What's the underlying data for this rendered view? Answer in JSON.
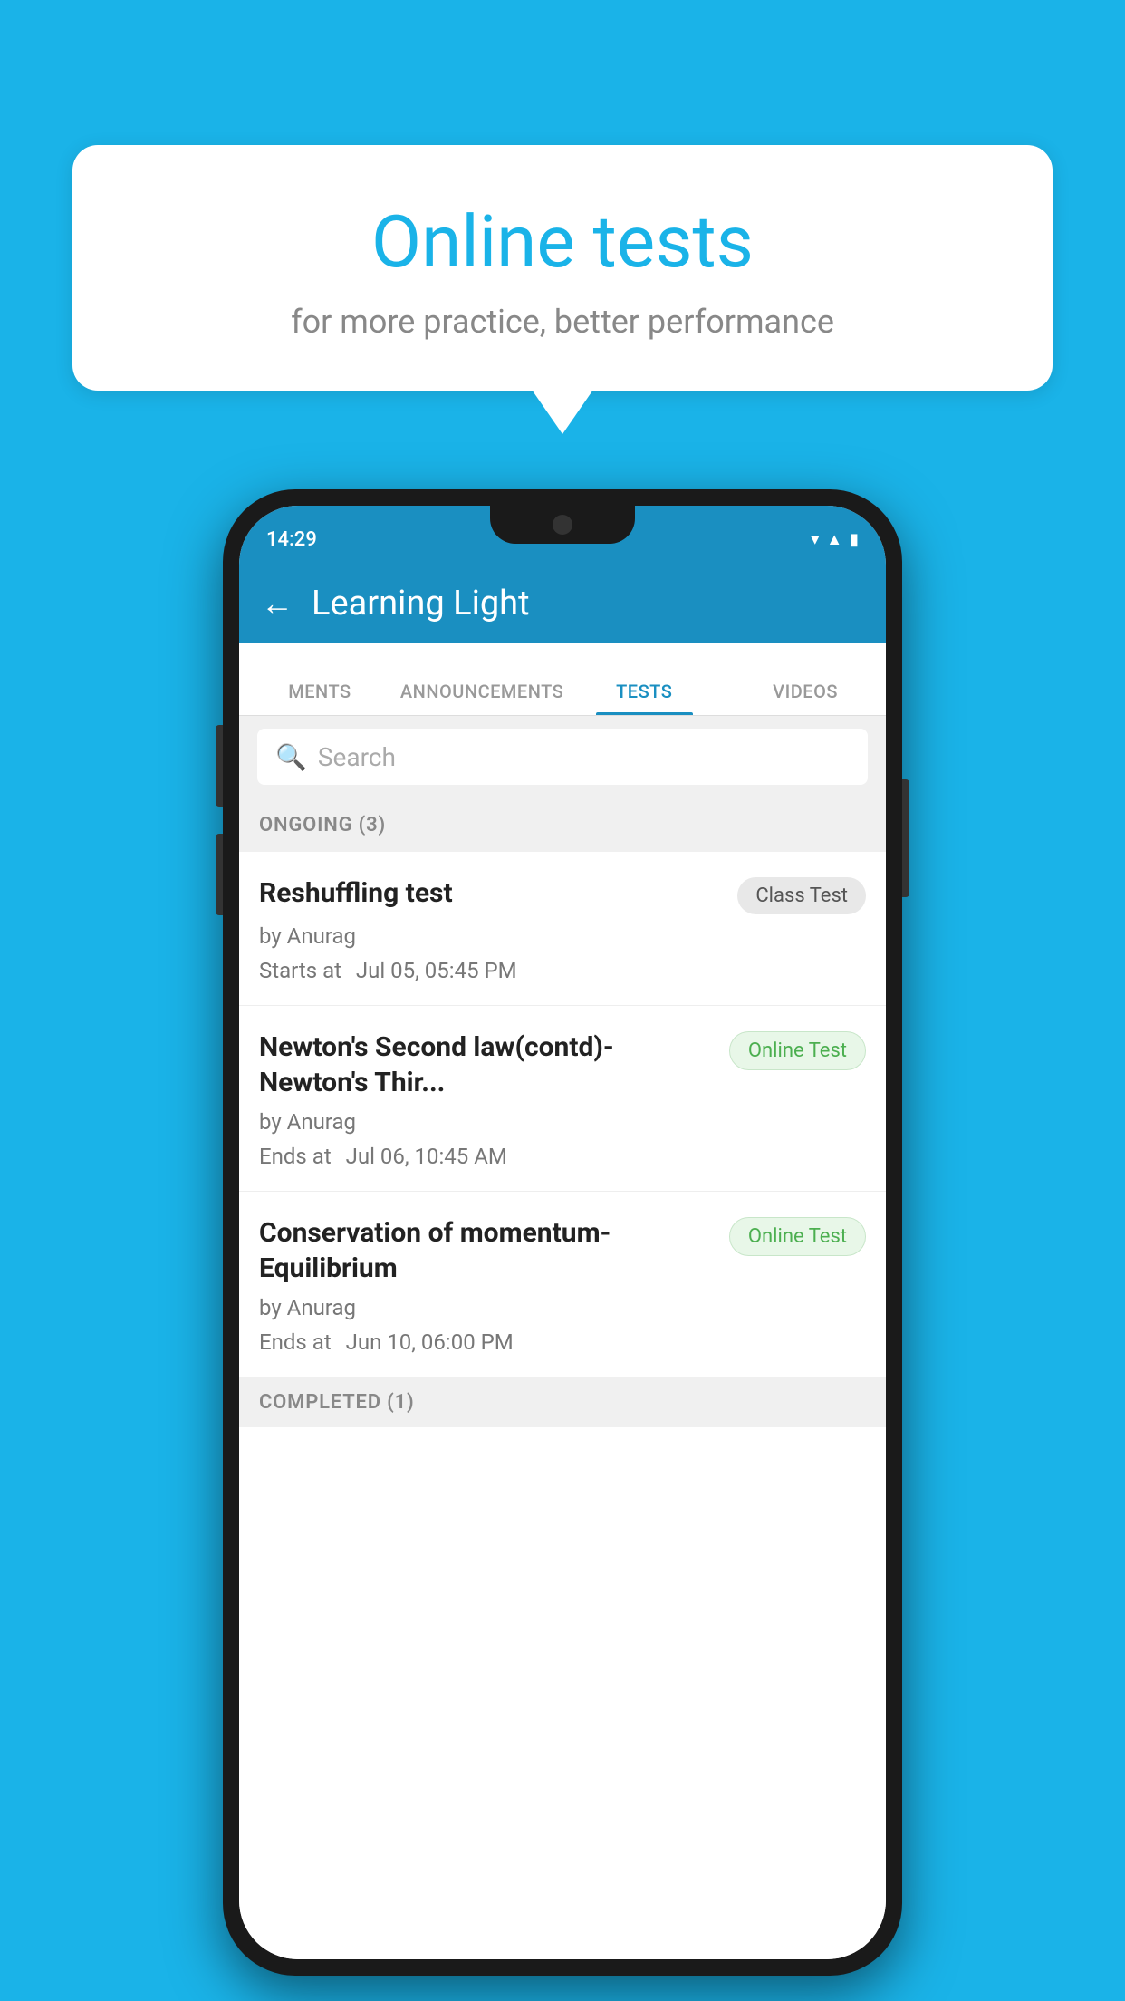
{
  "background": {
    "color": "#1ab3e8"
  },
  "bubble": {
    "title": "Online tests",
    "subtitle": "for more practice, better performance"
  },
  "status_bar": {
    "time": "14:29",
    "icons": [
      "wifi",
      "signal",
      "battery"
    ]
  },
  "app_bar": {
    "back_label": "←",
    "title": "Learning Light"
  },
  "tabs": [
    {
      "label": "MENTS",
      "active": false
    },
    {
      "label": "ANNOUNCEMENTS",
      "active": false
    },
    {
      "label": "TESTS",
      "active": true
    },
    {
      "label": "VIDEOS",
      "active": false
    }
  ],
  "search": {
    "placeholder": "Search"
  },
  "ongoing_section": {
    "label": "ONGOING (3)"
  },
  "tests": [
    {
      "name": "Reshuffling test",
      "badge": "Class Test",
      "badge_type": "class",
      "by": "by Anurag",
      "date_label": "Starts at",
      "date": "Jul 05, 05:45 PM"
    },
    {
      "name": "Newton's Second law(contd)-Newton's Thir...",
      "badge": "Online Test",
      "badge_type": "online",
      "by": "by Anurag",
      "date_label": "Ends at",
      "date": "Jul 06, 10:45 AM"
    },
    {
      "name": "Conservation of momentum-Equilibrium",
      "badge": "Online Test",
      "badge_type": "online",
      "by": "by Anurag",
      "date_label": "Ends at",
      "date": "Jun 10, 06:00 PM"
    }
  ],
  "completed_section": {
    "label": "COMPLETED (1)"
  }
}
